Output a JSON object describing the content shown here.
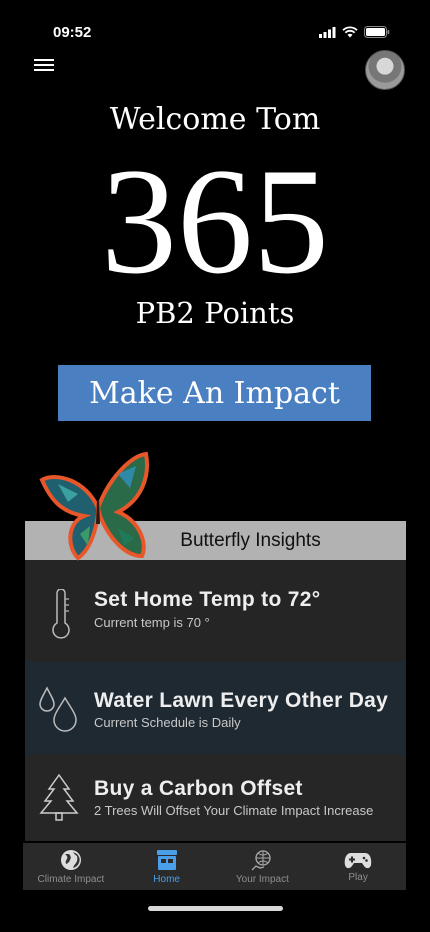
{
  "status_bar": {
    "time": "09:52"
  },
  "header": {
    "welcome": "Welcome Tom",
    "points_value": "365",
    "points_label": "PB2 Points"
  },
  "cta": {
    "label": "Make An Impact",
    "color": "#4a7fc1"
  },
  "insights": {
    "title": "Butterfly Insights",
    "items": [
      {
        "title": "Set Home Temp to 72°",
        "subtitle": "Current temp is 70 °",
        "icon": "thermometer-icon"
      },
      {
        "title": "Water Lawn Every Other Day",
        "subtitle": "Current Schedule is Daily",
        "icon": "water-drops-icon"
      },
      {
        "title": "Buy a Carbon Offset",
        "subtitle": "2 Trees Will Offset Your Climate Impact Increase",
        "icon": "tree-icon"
      }
    ]
  },
  "tabs": [
    {
      "label": "Climate Impact",
      "icon": "globe-icon"
    },
    {
      "label": "Home",
      "icon": "home-icon",
      "active": true
    },
    {
      "label": "Your Impact",
      "icon": "hand-globe-icon"
    },
    {
      "label": "Play",
      "icon": "gamepad-icon"
    }
  ],
  "colors": {
    "active_tab": "#4a9fe8",
    "panel_bg": "#252525"
  }
}
